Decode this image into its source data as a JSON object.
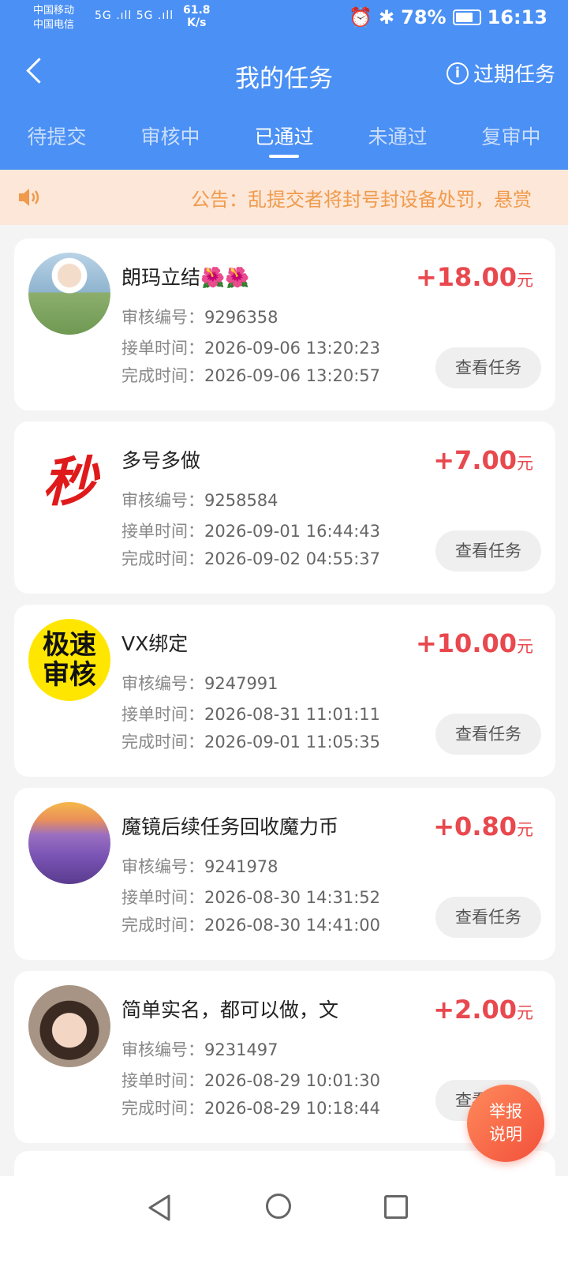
{
  "status_bar": {
    "carrier1": "中国移动",
    "carrier2": "中国电信",
    "signal": "5G .ıll 5G .ıll",
    "speed_value": "61.8",
    "speed_unit": "K/s",
    "battery": "78%",
    "battery_level": 0.78,
    "time": "16:13"
  },
  "nav": {
    "title": "我的任务",
    "expired_label": "过期任务",
    "info_glyph": "i"
  },
  "tabs": [
    {
      "label": "待提交",
      "active": false
    },
    {
      "label": "审核中",
      "active": false
    },
    {
      "label": "已通过",
      "active": true
    },
    {
      "label": "未通过",
      "active": false
    },
    {
      "label": "复审中",
      "active": false
    }
  ],
  "notice": {
    "text": "公告：乱提交者将封号封设备处罚，悬赏"
  },
  "labels": {
    "review_no": "审核编号：",
    "accept_time": "接单时间：",
    "finish_time": "完成时间：",
    "view_task": "查看任务",
    "unit": "元"
  },
  "tasks": [
    {
      "title": "朗玛立结🌺🌺",
      "review_no": "9296358",
      "accept_time": "2026-09-06 13:20:23",
      "finish_time": "2026-09-06 13:20:57",
      "reward": "+18.00",
      "avatar": "photo-girl"
    },
    {
      "title": "多号多做",
      "review_no": "9258584",
      "accept_time": "2026-09-01 16:44:43",
      "finish_time": "2026-09-02 04:55:37",
      "reward": "+7.00",
      "avatar": "miao-logo",
      "avatar_text": "秒"
    },
    {
      "title": "VX绑定",
      "review_no": "9247991",
      "accept_time": "2026-08-31 11:01:11",
      "finish_time": "2026-09-01 11:05:35",
      "reward": "+10.00",
      "avatar": "jisu-logo",
      "avatar_text": "极速\n审核"
    },
    {
      "title": "魔镜后续任务回收魔力币",
      "review_no": "9241978",
      "accept_time": "2026-08-30 14:31:52",
      "finish_time": "2026-08-30 14:41:00",
      "reward": "+0.80",
      "avatar": "lavender-photo"
    },
    {
      "title": "简单实名，都可以做，文",
      "review_no": "9231497",
      "accept_time": "2026-08-29 10:01:30",
      "finish_time": "2026-08-29 10:18:44",
      "reward": "+2.00",
      "avatar": "photo-woman"
    }
  ],
  "fab": {
    "line1": "举报",
    "line2": "说明"
  },
  "colors": {
    "primary": "#4b90f4",
    "reward": "#e8484e",
    "notice_bg": "#fde7d8",
    "notice_text": "#f09a4c",
    "fab": "#f2503a"
  }
}
